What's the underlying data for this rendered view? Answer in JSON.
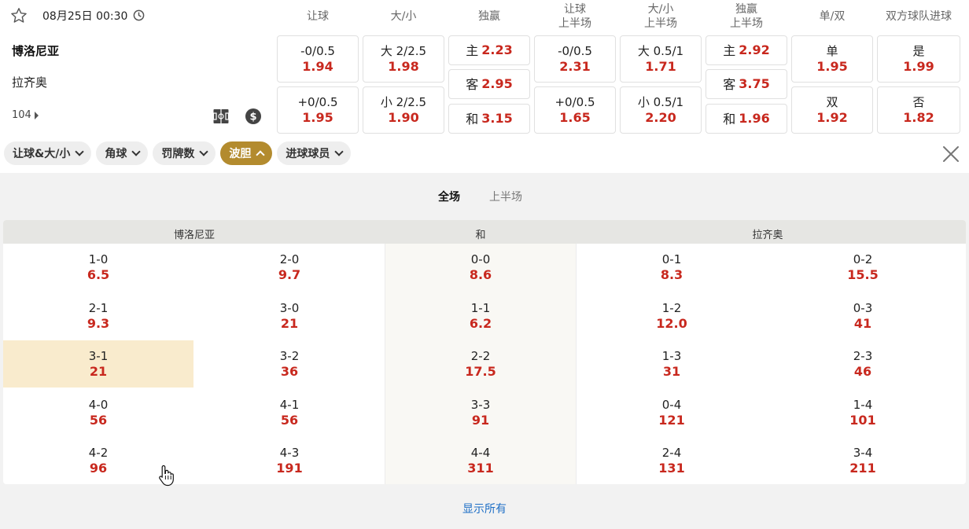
{
  "match": {
    "datetime": "08月25日 00:30",
    "home": "博洛尼亚",
    "away": "拉齐奥",
    "more_count": "104"
  },
  "markets": {
    "headers": [
      "让球",
      "大/小",
      "独赢",
      "让球\n上半场",
      "大/小\n上半场",
      "独赢\n上半场",
      "单/双",
      "双方球队进球"
    ],
    "handicap": [
      {
        "line": "-0/0.5",
        "odd": "1.94"
      },
      {
        "line": "+0/0.5",
        "odd": "1.95"
      }
    ],
    "total": [
      {
        "line": "大 2/2.5",
        "odd": "1.98"
      },
      {
        "line": "小 2/2.5",
        "odd": "1.90"
      }
    ],
    "moneyline": [
      {
        "label": "主",
        "odd": "2.23"
      },
      {
        "label": "客",
        "odd": "2.95"
      },
      {
        "label": "和",
        "odd": "3.15"
      }
    ],
    "handicap_1h": [
      {
        "line": "-0/0.5",
        "odd": "2.31"
      },
      {
        "line": "+0/0.5",
        "odd": "1.65"
      }
    ],
    "total_1h": [
      {
        "line": "大 0.5/1",
        "odd": "1.71"
      },
      {
        "line": "小 0.5/1",
        "odd": "2.20"
      }
    ],
    "moneyline_1h": [
      {
        "label": "主",
        "odd": "2.92"
      },
      {
        "label": "客",
        "odd": "3.75"
      },
      {
        "label": "和",
        "odd": "1.96"
      }
    ],
    "odd_even": [
      {
        "label": "单",
        "odd": "1.95"
      },
      {
        "label": "双",
        "odd": "1.92"
      }
    ],
    "btts": [
      {
        "label": "是",
        "odd": "1.99"
      },
      {
        "label": "否",
        "odd": "1.82"
      }
    ]
  },
  "chips": [
    {
      "label": "让球&大/小"
    },
    {
      "label": "角球"
    },
    {
      "label": "罚牌数"
    },
    {
      "label": "波胆"
    },
    {
      "label": "进球球员"
    }
  ],
  "panel": {
    "tabs": [
      "全场",
      "上半场"
    ],
    "columns": {
      "home": "博洛尼亚",
      "draw": "和",
      "away": "拉齐奥"
    },
    "home_scores": [
      [
        {
          "score": "1-0",
          "odd": "6.5"
        },
        {
          "score": "2-0",
          "odd": "9.7"
        }
      ],
      [
        {
          "score": "2-1",
          "odd": "9.3"
        },
        {
          "score": "3-0",
          "odd": "21"
        }
      ],
      [
        {
          "score": "3-1",
          "odd": "21"
        },
        {
          "score": "3-2",
          "odd": "36"
        }
      ],
      [
        {
          "score": "4-0",
          "odd": "56"
        },
        {
          "score": "4-1",
          "odd": "56"
        }
      ],
      [
        {
          "score": "4-2",
          "odd": "96"
        },
        {
          "score": "4-3",
          "odd": "191"
        }
      ]
    ],
    "draw_scores": [
      {
        "score": "0-0",
        "odd": "8.6"
      },
      {
        "score": "1-1",
        "odd": "6.2"
      },
      {
        "score": "2-2",
        "odd": "17.5"
      },
      {
        "score": "3-3",
        "odd": "91"
      },
      {
        "score": "4-4",
        "odd": "311"
      }
    ],
    "away_scores": [
      [
        {
          "score": "0-1",
          "odd": "8.3"
        },
        {
          "score": "0-2",
          "odd": "15.5"
        }
      ],
      [
        {
          "score": "1-2",
          "odd": "12.0"
        },
        {
          "score": "0-3",
          "odd": "41"
        }
      ],
      [
        {
          "score": "1-3",
          "odd": "31"
        },
        {
          "score": "2-3",
          "odd": "46"
        }
      ],
      [
        {
          "score": "0-4",
          "odd": "121"
        },
        {
          "score": "1-4",
          "odd": "101"
        }
      ],
      [
        {
          "score": "2-4",
          "odd": "131"
        },
        {
          "score": "3-4",
          "odd": "211"
        }
      ]
    ],
    "show_all": "显示所有"
  },
  "colors": {
    "odds": "#c8281e",
    "active_chip": "#b38b2e",
    "highlight": "#f9ebcd",
    "link": "#1e6fc6"
  }
}
